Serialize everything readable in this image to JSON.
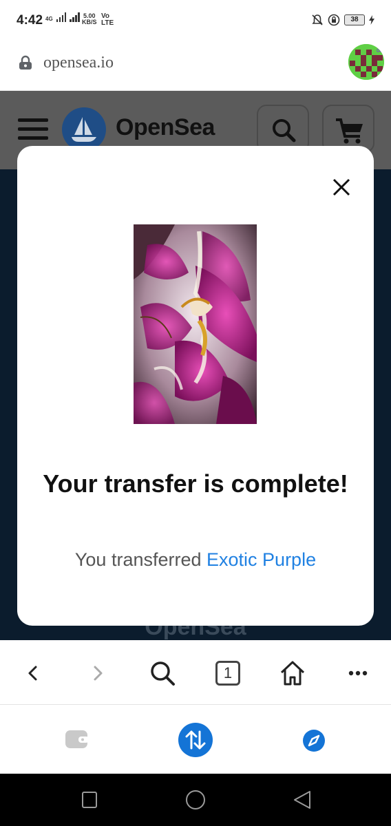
{
  "status_bar": {
    "time": "4:42",
    "net_type": "4G",
    "data_rate": "5.00",
    "data_unit": "KB/S",
    "volte": "Vo",
    "volte_sub": "LTE",
    "battery": "38"
  },
  "url_bar": {
    "url": "opensea.io"
  },
  "site": {
    "name": "OpenSea",
    "footer_word": "OpenSea"
  },
  "modal": {
    "title": "Your transfer is complete!",
    "subtitle_prefix": "You transferred ",
    "item_name": "Exotic Purple"
  },
  "browser_toolbar": {
    "tab_count": "1"
  },
  "colors": {
    "link_blue": "#2081e2",
    "opensea_blue": "#2081e2",
    "page_dark": "#0b1c2d"
  },
  "icons": [
    "lock-icon",
    "avatar-icon",
    "close-icon",
    "back-icon",
    "forward-icon",
    "search-icon",
    "tabs-icon",
    "home-icon",
    "more-icon",
    "wallet-icon",
    "swap-icon",
    "explore-icon",
    "recent-apps-icon",
    "home-nav-icon",
    "back-nav-icon"
  ]
}
